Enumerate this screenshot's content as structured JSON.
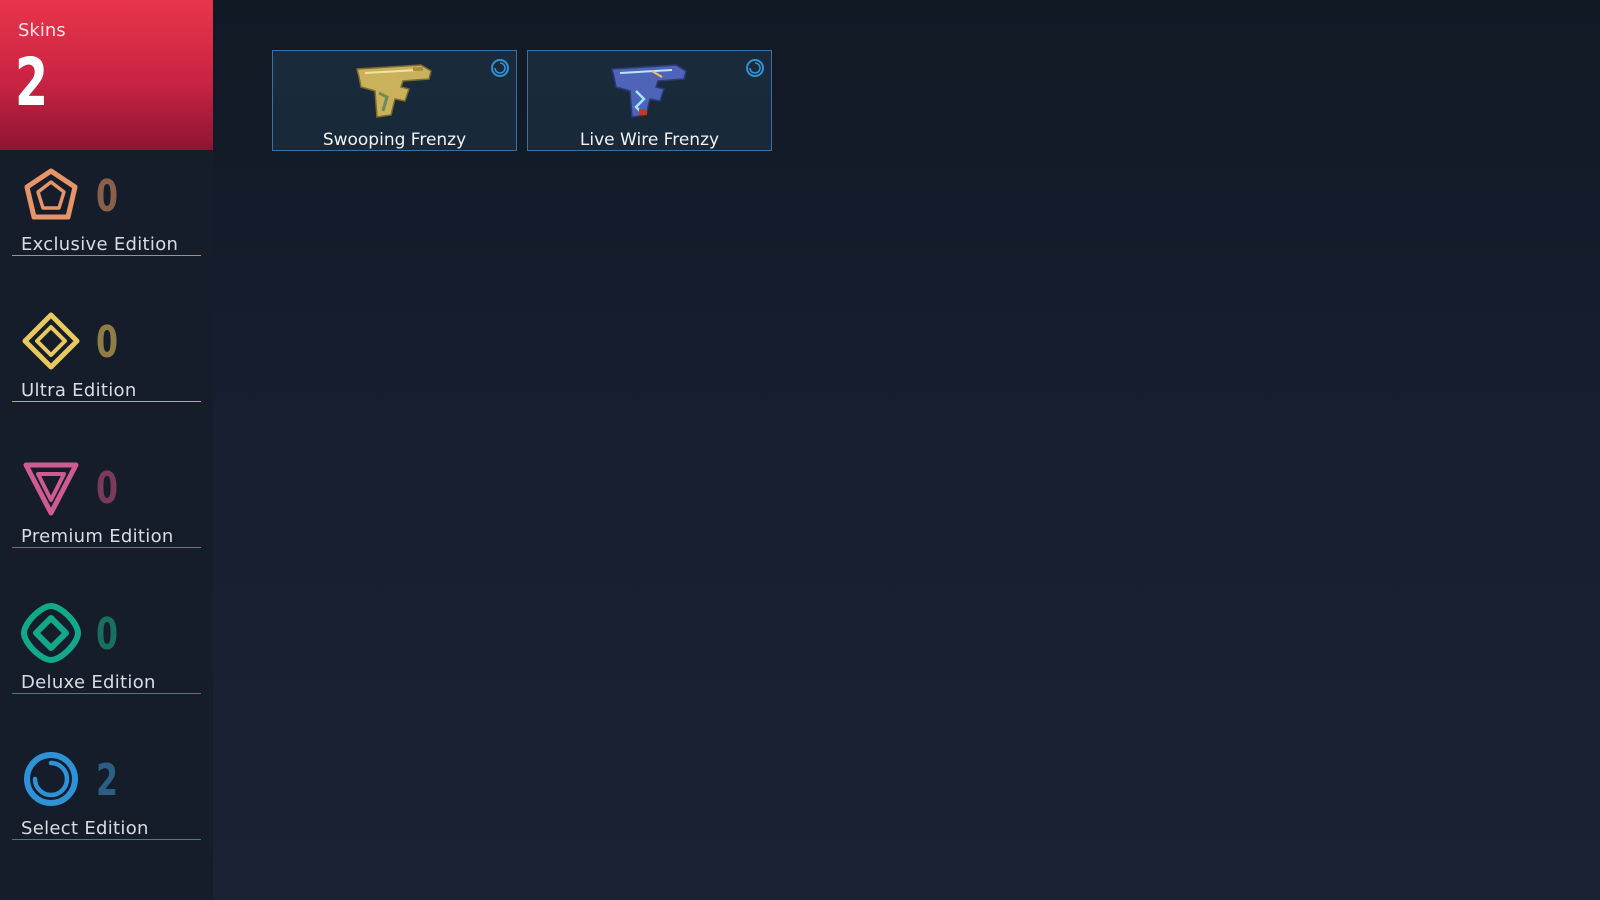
{
  "sidebar": {
    "total": {
      "label": "Skins",
      "count": "2"
    },
    "editions": [
      {
        "name": "Exclusive Edition",
        "count": "0",
        "icon": "exclusive-edition-icon",
        "color": "#e79469",
        "count_color": "#8a6048",
        "rule_color": "#b78a73"
      },
      {
        "name": "Ultra Edition",
        "count": "0",
        "icon": "ultra-edition-icon",
        "color": "#e8c95e",
        "count_color": "#8f7d45",
        "rule_color": "#b9aa72"
      },
      {
        "name": "Premium Edition",
        "count": "0",
        "icon": "premium-edition-icon",
        "color": "#d05a92",
        "count_color": "#7a3a5c",
        "rule_color": "#a75679"
      },
      {
        "name": "Deluxe Edition",
        "count": "0",
        "icon": "deluxe-edition-icon",
        "color": "#14a88a",
        "count_color": "#187060",
        "rule_color": "#2a8e7c"
      },
      {
        "name": "Select Edition",
        "count": "2",
        "icon": "select-edition-icon",
        "color": "#2f91d6",
        "count_color": "#2b5f86",
        "rule_color": "#3b7cb0"
      }
    ]
  },
  "skins": [
    {
      "name": "Swooping Frenzy",
      "icon": "pistol-icon",
      "tier_icon": "select-edition-icon",
      "accent": "#c9b25b"
    },
    {
      "name": "Live Wire Frenzy",
      "icon": "pistol-icon",
      "tier_icon": "select-edition-icon",
      "accent": "#5d79c9"
    }
  ]
}
